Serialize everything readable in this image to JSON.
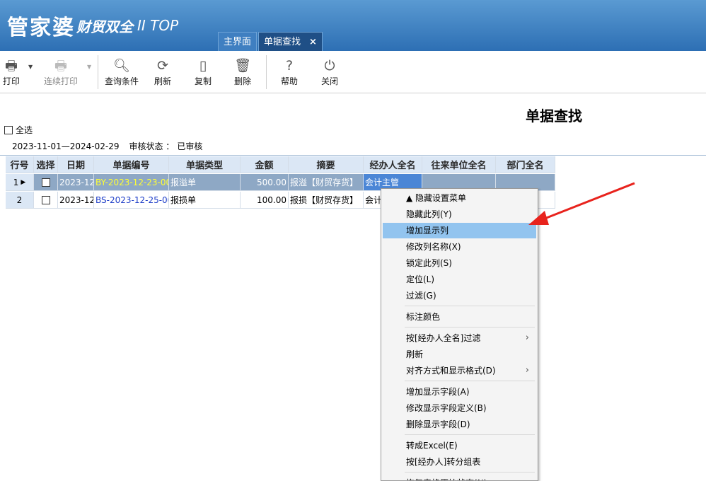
{
  "app": {
    "brand_main": "管家婆",
    "brand_sub": "财贸双全",
    "brand_version": "II TOP"
  },
  "tabs": [
    {
      "label": "主界面"
    },
    {
      "label": "单据查找",
      "close": "×"
    }
  ],
  "toolbar": {
    "print": "打印",
    "continuous_print": "连续打印",
    "query": "查询条件",
    "refresh": "刷新",
    "copy": "复制",
    "delete": "删除",
    "help": "帮助",
    "close": "关闭"
  },
  "page": {
    "title": "单据查找",
    "select_all": "全选",
    "date_range": "2023-11-01—2024-02-29",
    "audit_status_label": "审核状态 ：",
    "audit_status_value": "已审核"
  },
  "table": {
    "columns": [
      "行号",
      "选择",
      "日期",
      "单据编号",
      "单据类型",
      "金额",
      "摘要",
      "经办人全名",
      "往来单位全名",
      "部门全名"
    ],
    "rows": [
      {
        "no": "1",
        "date": "2023-12-",
        "code": "BY-2023-12-23-00(",
        "type": "报溢单",
        "amount": "500.00",
        "summary": "报溢【财贸存货】",
        "handler": "会计主管"
      },
      {
        "no": "2",
        "date": "2023-12-",
        "code": "BS-2023-12-25-00(",
        "type": "报损单",
        "amount": "100.00",
        "summary": "报损【财贸存货】",
        "handler": "会计"
      }
    ]
  },
  "context_menu": {
    "items": [
      {
        "label": "▲ 隐藏设置菜单"
      },
      {
        "label": "隐藏此列(Y)"
      },
      {
        "label": "增加显示列"
      },
      {
        "label": "修改列名称(X)"
      },
      {
        "label": "锁定此列(S)"
      },
      {
        "label": "定位(L)"
      },
      {
        "label": "过滤(G)"
      },
      {
        "label": "标注颜色"
      },
      {
        "label": "按[经办人全名]过滤"
      },
      {
        "label": "刷新"
      },
      {
        "label": "对齐方式和显示格式(D)"
      },
      {
        "label": "增加显示字段(A)"
      },
      {
        "label": "修改显示字段定义(B)"
      },
      {
        "label": "删除显示字段(D)"
      },
      {
        "label": "转成Excel(E)"
      },
      {
        "label": "按[经办人]转分组表"
      },
      {
        "label": "恢复表格原始状态(N)"
      }
    ],
    "submenu_chevron": "›"
  },
  "annotation": {
    "color": "#e8231d"
  },
  "colors": {
    "titlebar": "#2d6fb4",
    "selected_row": "#8ea8c5",
    "menu_highlight": "#92c4ef",
    "header": "#dbe7f5"
  }
}
